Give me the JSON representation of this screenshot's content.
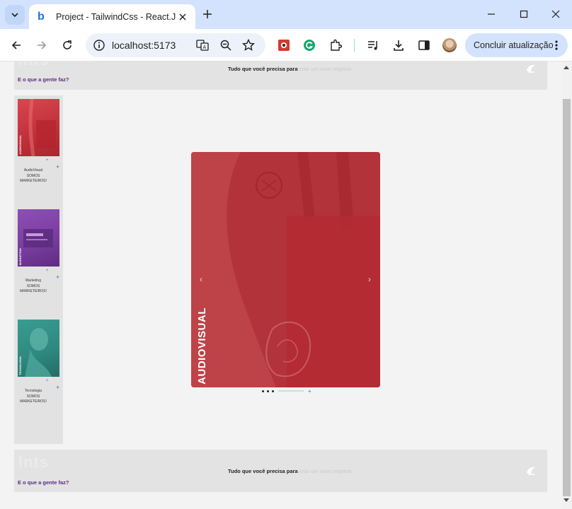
{
  "browser": {
    "tab_title": "Project - TailwindCss - React.JS",
    "tab_favicon": "b",
    "url": "localhost:5173",
    "update_button": "Concluir atualização",
    "icons": [
      "back-icon",
      "forward-icon",
      "reload-icon",
      "site-info-icon",
      "translate-icon",
      "zoom-icon",
      "bookmark-star-icon",
      "extension-red-icon",
      "grammarly-icon",
      "extensions-puzzle-icon",
      "media-control-icon",
      "download-icon",
      "side-panel-icon",
      "profile-avatar",
      "menu-dots-icon"
    ]
  },
  "header": {
    "ghost_logo": "lnts",
    "tagline_bold": "Tudo que você precisa para",
    "tagline_faded": "criar um novo negócio",
    "link": "E o que a gente faz?"
  },
  "sidebar": {
    "cards": [
      {
        "category": "AudioVisual",
        "subtitle": "SOMOS MARKETEIROS!",
        "color": "#c2323a",
        "vlabel": "AUDIOVISUAL"
      },
      {
        "category": "Marketing",
        "subtitle": "SOMOS MARKETEIROS!",
        "color": "#7a3ea1",
        "vlabel": "MARKETING"
      },
      {
        "category": "Tecnologia",
        "subtitle": "SOMOS MARKETEIROS!",
        "color": "#2f8a80",
        "vlabel": "TECNOLOGIA"
      }
    ]
  },
  "carousel": {
    "title": "AUDIOVISUAL",
    "prev": "‹",
    "next": "›",
    "plus": "+",
    "accent": "#b7343b"
  },
  "footer": {
    "ghost_logo": "lnts",
    "tagline_bold": "Tudo que você precisa para",
    "tagline_faded": "criar um novo negócio",
    "link": "E o que a gente faz?"
  }
}
